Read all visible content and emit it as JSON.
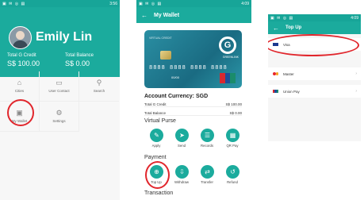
{
  "status_time": [
    "3:56",
    "4:09",
    "4:09"
  ],
  "screen1": {
    "user_name": "Emily Lin",
    "total_g_credit_label": "Total G Credit",
    "total_g_credit_value": "S$ 100.00",
    "total_balance_label": "Total Balance",
    "total_balance_value": "S$ 0.00",
    "grid": [
      {
        "label": "Cities",
        "icon": "home-icon"
      },
      {
        "label": "User Contact",
        "icon": "card-icon"
      },
      {
        "label": "Search",
        "icon": "search-icon"
      },
      {
        "label": "My Wallet",
        "icon": "wallet-icon"
      },
      {
        "label": "Settings",
        "icon": "gear-icon"
      }
    ]
  },
  "screen2": {
    "title": "My Wallet",
    "card_bank": "VIRTUAL CREDIT",
    "card_number": "8888 8888 8888 8888",
    "card_valid": "00/00",
    "card_brand": "GREENLINK",
    "account_currency": "Account Currency: SGD",
    "total_g_credit_label": "Total G Credit",
    "total_g_credit_value": "S$ 100.00",
    "total_balance_label": "Total Balance",
    "total_balance_value": "S$ 0.00",
    "virtual_purse_title": "Virtual Purse",
    "virtual_purse": [
      "Apply",
      "Send",
      "Records",
      "QR Pay"
    ],
    "payment_title": "Payment",
    "payment": [
      "Top Up",
      "Withdraw",
      "Transfer",
      "Refund"
    ],
    "transaction_title": "Transaction"
  },
  "screen3": {
    "title": "Top Up",
    "methods": [
      "Visa",
      "Master",
      "Union Pay"
    ]
  },
  "colors": {
    "teal": "#1bab9d",
    "highlight_ring": "#e1262c"
  }
}
